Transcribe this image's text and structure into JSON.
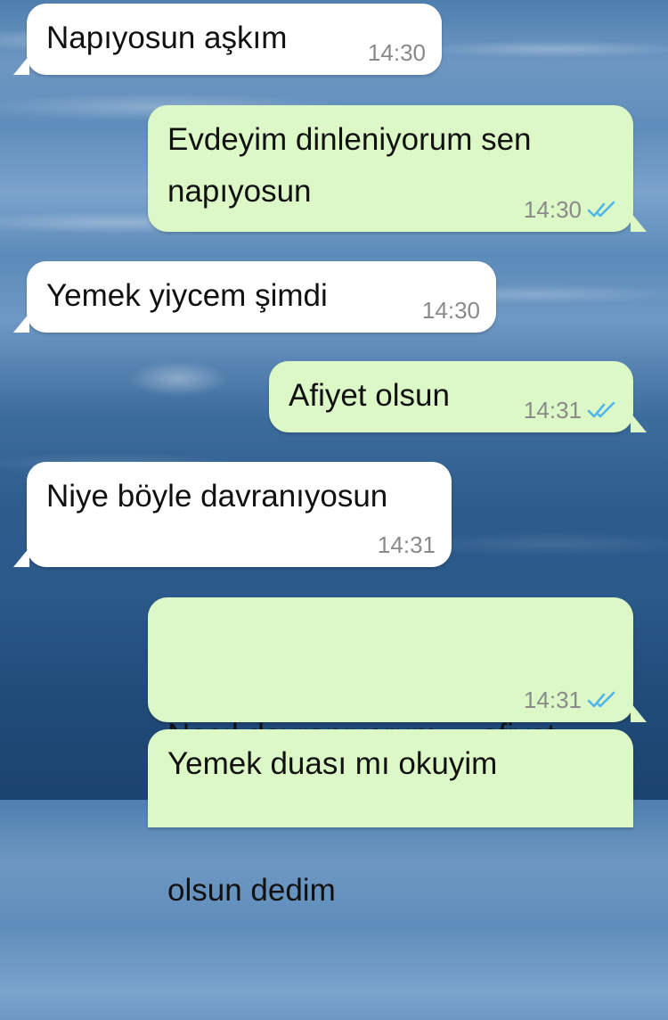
{
  "chat": {
    "messages": [
      {
        "direction": "incoming",
        "lines": [
          "Napıyosun aşkım"
        ],
        "time": "14:30"
      },
      {
        "direction": "outgoing",
        "lines": [
          "Evdeyim dinleniyorum sen",
          "napıyosun"
        ],
        "time": "14:30",
        "ticks": "double-check-icon"
      },
      {
        "direction": "incoming",
        "lines": [
          "Yemek yiycem şimdi"
        ],
        "time": "14:30"
      },
      {
        "direction": "outgoing",
        "lines": [
          "Afiyet olsun"
        ],
        "time": "14:31",
        "ticks": "double-check-icon"
      },
      {
        "direction": "incoming",
        "lines": [
          "Niye böyle davranıyosun"
        ],
        "time": "14:31"
      },
      {
        "direction": "outgoing",
        "lines": [
          "Nasıl davranıyorum     afiyet",
          "olsun dedim"
        ],
        "time": "14:31",
        "ticks": "double-check-icon"
      },
      {
        "direction": "outgoing",
        "lines": [
          "Yemek duası mı okuyim"
        ]
      }
    ]
  },
  "colors": {
    "incoming_bubble": "#ffffff",
    "outgoing_bubble": "#dcf8c6",
    "timestamp": "#8a8a8a",
    "read_ticks": "#4fb6ec"
  }
}
